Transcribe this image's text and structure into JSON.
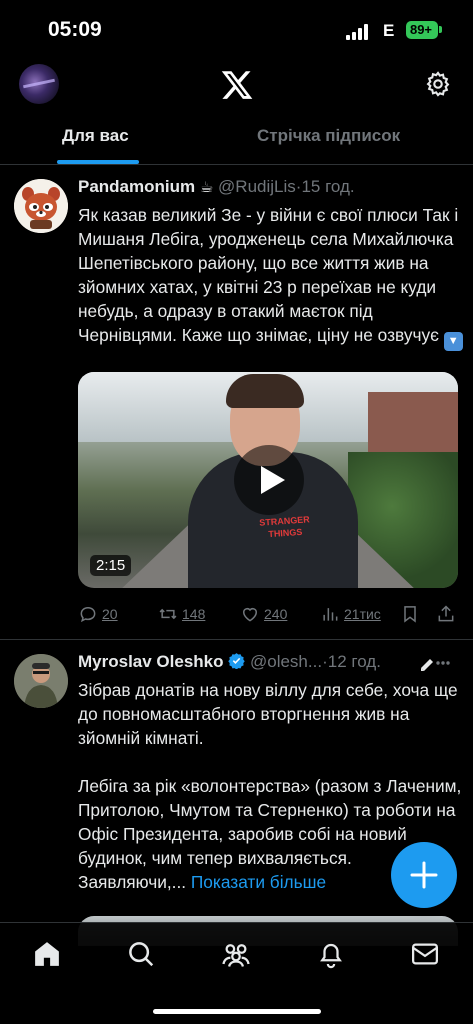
{
  "status_bar": {
    "time": "05:09",
    "carrier": "E",
    "battery": "89+"
  },
  "header": {
    "logo": "x-logo-icon",
    "settings_icon": "gear-icon"
  },
  "tabs": [
    {
      "label": "Для вас",
      "active": true
    },
    {
      "label": "Стрічка підписок",
      "active": false
    }
  ],
  "colors": {
    "accent": "#1d9bf0",
    "background": "#000000",
    "muted": "#71767b",
    "text": "#e7e9ea"
  },
  "tweets": [
    {
      "name": "Pandamonium",
      "name_emoji": "☕",
      "handle": "@RudijLis",
      "dot": "·",
      "time": "15 год.",
      "text": "Як казав великий Зе - у війни є свої плюси Так і Мишаня Лебіга, уродженець села Михайлючка Шепетівського району, що все життя жив на зйомних хатах, у квітні 23 р переїхав не куди небудь, а одразу в отакий маєток під Чернівцями. Каже що знімає, ціну не озвучує",
      "media": {
        "type": "video",
        "duration": "2:15",
        "shirt_print": "STRANGER THINGS"
      },
      "stats": {
        "replies": "20",
        "retweets": "148",
        "likes": "240",
        "views": "21тис"
      }
    },
    {
      "name": "Myroslav Oleshko",
      "handle": "@olesh...",
      "dot": "·",
      "time": "12 год.",
      "verified": true,
      "text_p1": "Зібрав донатів на нову віллу для себе, хоча ще до повномасштабного вторгнення жив на зйомній кімнаті.",
      "text_p2": "Лебіга за рік «волонтерства» (разом з Лаченим, Притолою, Чмутом та Стерненко) та роботи на Офіс Президента, заробив собі на новий будинок, чим тепер вихваляється.",
      "text_p3": "Заявляючи,...",
      "show_more": "Показати більше"
    }
  ],
  "fab": {
    "icon": "plus-icon"
  },
  "bottom_nav": [
    {
      "name": "home",
      "icon": "home-icon",
      "active": true
    },
    {
      "name": "search",
      "icon": "search-icon"
    },
    {
      "name": "communities",
      "icon": "communities-icon"
    },
    {
      "name": "notifications",
      "icon": "bell-icon"
    },
    {
      "name": "messages",
      "icon": "envelope-icon"
    }
  ]
}
